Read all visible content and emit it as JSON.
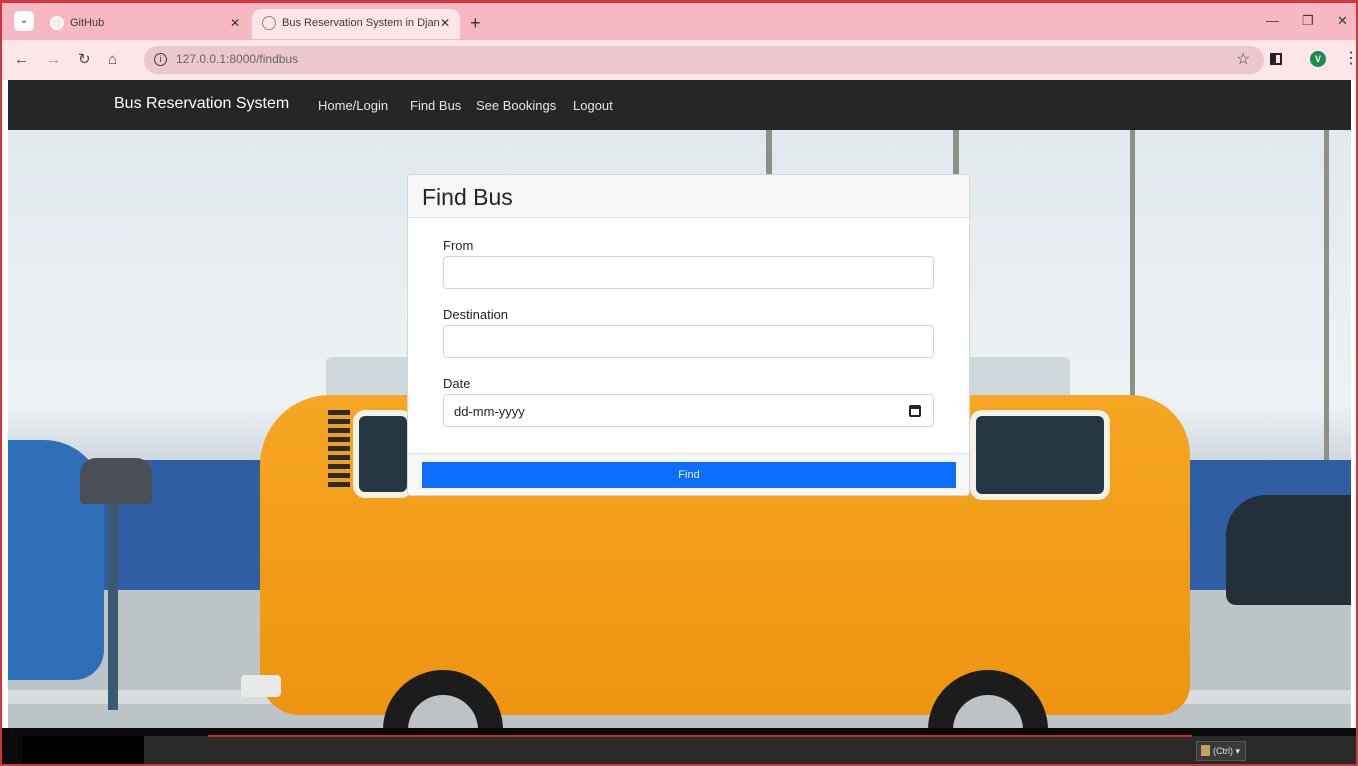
{
  "browser": {
    "tabs": [
      {
        "title": "GitHub",
        "active": false
      },
      {
        "title": "Bus Reservation System in Djan",
        "active": true
      }
    ],
    "url": "127.0.0.1:8000/findbus",
    "profile_initial": "V",
    "accent": "#f6b8c2"
  },
  "app_nav": {
    "brand": "Bus Reservation System",
    "links": [
      "Home/Login",
      "Find Bus",
      "See Bookings",
      "Logout"
    ]
  },
  "find_bus_form": {
    "title": "Find Bus",
    "from_label": "From",
    "from_value": "",
    "destination_label": "Destination",
    "destination_value": "",
    "date_label": "Date",
    "date_placeholder": "dd-mm-yyyy",
    "submit_label": "Find",
    "button_color": "#0d6efd"
  },
  "taskbar": {
    "paste_options_label": "(Ctrl)"
  }
}
